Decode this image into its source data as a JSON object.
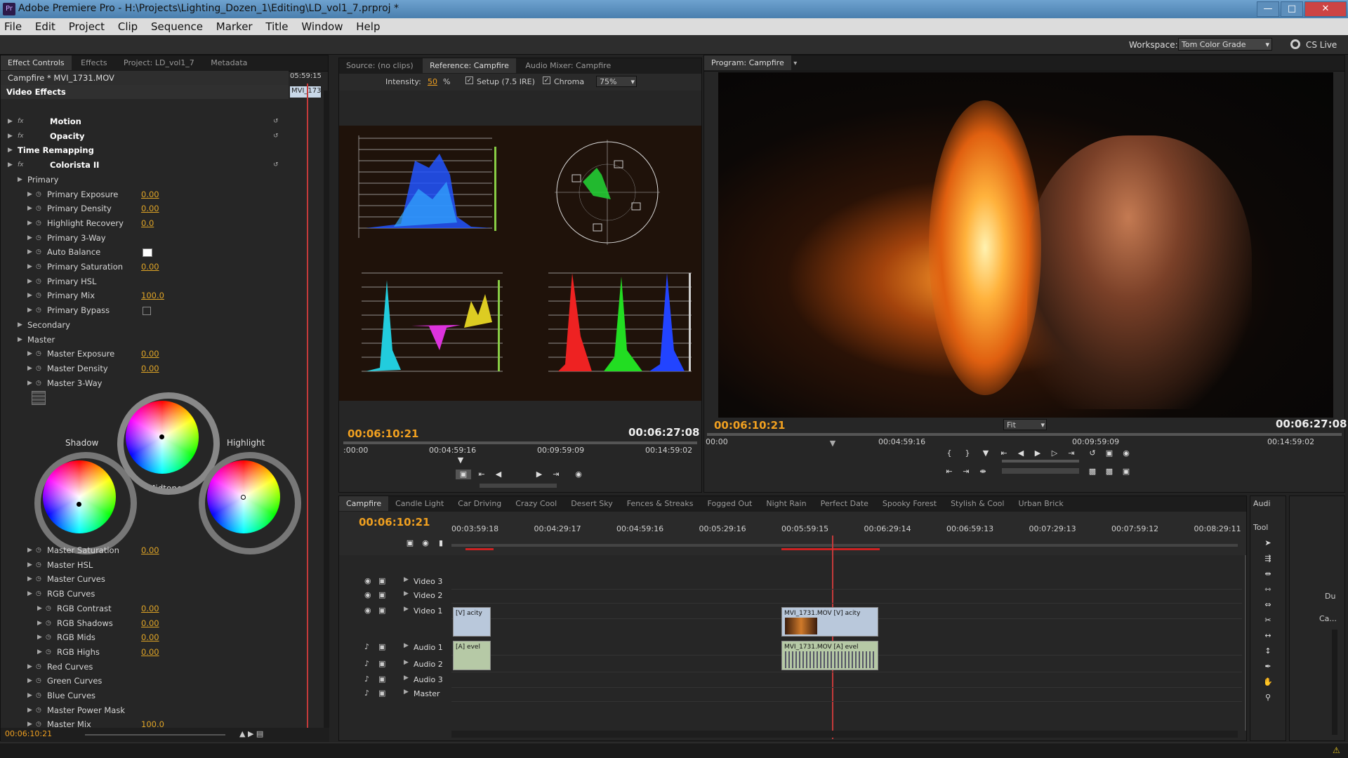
{
  "app": {
    "title": "Adobe Premiere Pro - H:\\Projects\\Lighting_Dozen_1\\Editing\\LD_vol1_7.prproj *",
    "icon": "Pr",
    "menu": [
      "File",
      "Edit",
      "Project",
      "Clip",
      "Sequence",
      "Marker",
      "Title",
      "Window",
      "Help"
    ],
    "workspace_label": "Workspace:",
    "workspace_value": "Tom Color Grade",
    "cslive": "CS Live"
  },
  "left_panel": {
    "tabs": [
      "Effect Controls",
      "Effects",
      "Project: LD_vol1_7",
      "Metadata"
    ],
    "clip_title": "Campfire * MVI_1731.MOV",
    "mini_tc": "05:59:15",
    "mini_clip": "MVI_173",
    "video_effects_label": "Video Effects",
    "rows": [
      {
        "label": "Motion",
        "bold": true,
        "indent": 0,
        "fx": true
      },
      {
        "label": "Opacity",
        "bold": true,
        "indent": 0,
        "fx": true
      },
      {
        "label": "Time Remapping",
        "bold": true,
        "indent": 0,
        "fx": false
      },
      {
        "label": "Colorista II",
        "bold": true,
        "indent": 0,
        "fx": true
      },
      {
        "label": "Primary",
        "indent": 1
      },
      {
        "label": "Primary Exposure",
        "indent": 2,
        "value": "0.00"
      },
      {
        "label": "Primary Density",
        "indent": 2,
        "value": "0.00"
      },
      {
        "label": "Highlight Recovery",
        "indent": 2,
        "value": "0.0"
      },
      {
        "label": "Primary 3-Way",
        "indent": 2
      },
      {
        "label": "Auto Balance",
        "indent": 2,
        "swatch": true
      },
      {
        "label": "Primary Saturation",
        "indent": 2,
        "value": "0.00"
      },
      {
        "label": "Primary HSL",
        "indent": 2
      },
      {
        "label": "Primary Mix",
        "indent": 2,
        "value": "100.0"
      },
      {
        "label": "Primary Bypass",
        "indent": 2,
        "checkbox": true
      },
      {
        "label": "Secondary",
        "indent": 1
      },
      {
        "label": "Master",
        "indent": 1
      },
      {
        "label": "Master Exposure",
        "indent": 2,
        "value": "0.00"
      },
      {
        "label": "Master Density",
        "indent": 2,
        "value": "0.00"
      },
      {
        "label": "Master 3-Way",
        "indent": 2
      }
    ],
    "wheel_labels": {
      "shadow": "Shadow",
      "midtone": "Midtone",
      "highlight": "Highlight"
    },
    "rows2": [
      {
        "label": "Master Saturation",
        "indent": 2,
        "value": "0.00"
      },
      {
        "label": "Master HSL",
        "indent": 2
      },
      {
        "label": "Master Curves",
        "indent": 2
      },
      {
        "label": "RGB Curves",
        "indent": 2
      },
      {
        "label": "RGB Contrast",
        "indent": 3,
        "value": "0.00"
      },
      {
        "label": "RGB Shadows",
        "indent": 3,
        "value": "0.00"
      },
      {
        "label": "RGB Mids",
        "indent": 3,
        "value": "0.00"
      },
      {
        "label": "RGB Highs",
        "indent": 3,
        "value": "0.00"
      },
      {
        "label": "Red Curves",
        "indent": 2
      },
      {
        "label": "Green Curves",
        "indent": 2
      },
      {
        "label": "Blue Curves",
        "indent": 2
      },
      {
        "label": "Master Power Mask",
        "indent": 2
      },
      {
        "label": "Master Mix",
        "indent": 2,
        "value": "100.0"
      }
    ],
    "bottom_tc": "00:06:10:21"
  },
  "reference": {
    "tabs": [
      "Source: (no clips)",
      "Reference: Campfire",
      "Audio Mixer: Campfire"
    ],
    "intensity_label": "Intensity:",
    "intensity_value": "50",
    "intensity_unit": "%",
    "setup_label": "Setup (7.5 IRE)",
    "chroma_label": "Chroma",
    "zoom": "75%",
    "tc_current": "00:06:10:21",
    "tc_duration": "00:06:27:08",
    "ruler": [
      ":00:00",
      "00:04:59:16",
      "00:09:59:09",
      "00:14:59:02"
    ]
  },
  "program": {
    "tab": "Program: Campfire",
    "tc_current": "00:06:10:21",
    "tc_duration": "00:06:27:08",
    "fit": "Fit",
    "ruler": [
      "00:00",
      "00:04:59:16",
      "00:09:59:09",
      "00:14:59:02"
    ]
  },
  "timeline": {
    "tabs": [
      "Campfire",
      "Candle Light",
      "Car Driving",
      "Crazy Cool",
      "Desert Sky",
      "Fences & Streaks",
      "Fogged Out",
      "Night Rain",
      "Perfect Date",
      "Spooky Forest",
      "Stylish & Cool",
      "Urban Brick"
    ],
    "tc": "00:06:10:21",
    "ruler": [
      "00:03:59:18",
      "00:04:29:17",
      "00:04:59:16",
      "00:05:29:16",
      "00:05:59:15",
      "00:06:29:14",
      "00:06:59:13",
      "00:07:29:13",
      "00:07:59:12",
      "00:08:29:11"
    ],
    "tracks": [
      "Video 3",
      "Video 2",
      "Video 1",
      "Audio 1",
      "Audio 2",
      "Audio 3",
      "Master"
    ],
    "clip_v_left": "[V] acity",
    "clip_a_left": "[A] evel",
    "clip_v_right": "MVI_1731.MOV [V] acity",
    "clip_a_right": "MVI_1731.MOV [A] evel"
  },
  "right_strip": {
    "audio_tab": "Audi",
    "tools_tab": "Tool",
    "du": "Du",
    "ca": "Ca..."
  }
}
